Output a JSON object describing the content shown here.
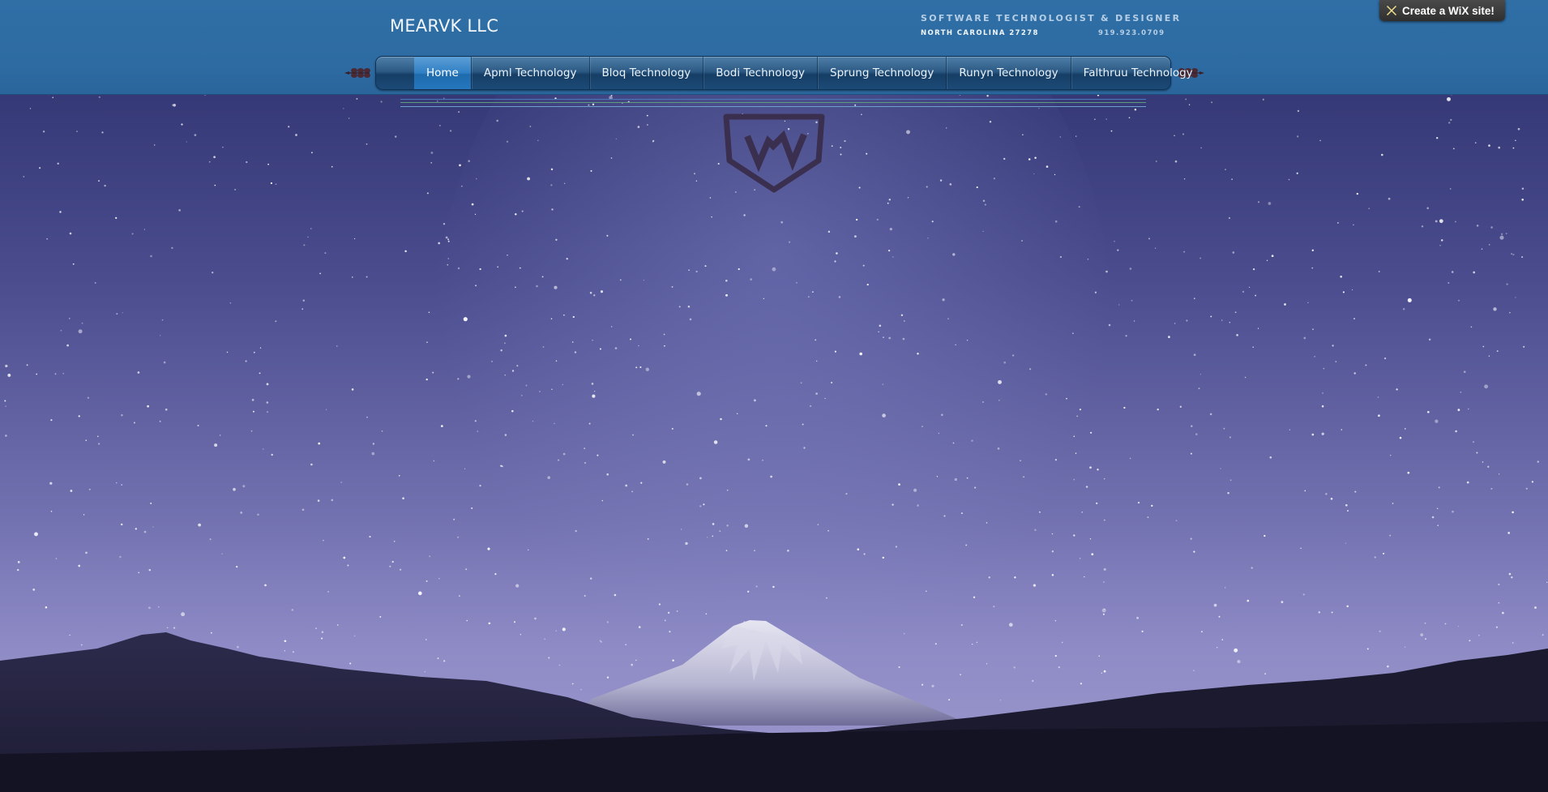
{
  "header": {
    "site_title": "MEARVK LLC",
    "tagline": "SOFTWARE TECHNOLOGIST & DESIGNER",
    "location": "NORTH CAROLINA 27278",
    "phone": "919.923.0709"
  },
  "nav": {
    "items": [
      {
        "label": "Home",
        "active": true
      },
      {
        "label": "Apml Technology",
        "active": false
      },
      {
        "label": "Bloq Technology",
        "active": false
      },
      {
        "label": "Bodi Technology",
        "active": false
      },
      {
        "label": "Sprung Technology",
        "active": false
      },
      {
        "label": "Runyn Technology",
        "active": false
      },
      {
        "label": "Falthruu Technology",
        "active": false
      }
    ]
  },
  "wix_badge": {
    "label": "Create a WiX site!",
    "icon": "wix-star-icon"
  },
  "background": {
    "icon": "starry-sky-mountain-image"
  },
  "logo": {
    "icon": "vv-shield-logo-icon"
  },
  "colors": {
    "header_blue": "#2d6ba2",
    "nav_active": "#2f7fc4",
    "sky_top": "#2f3470",
    "sky_bottom": "#8a86c4"
  }
}
